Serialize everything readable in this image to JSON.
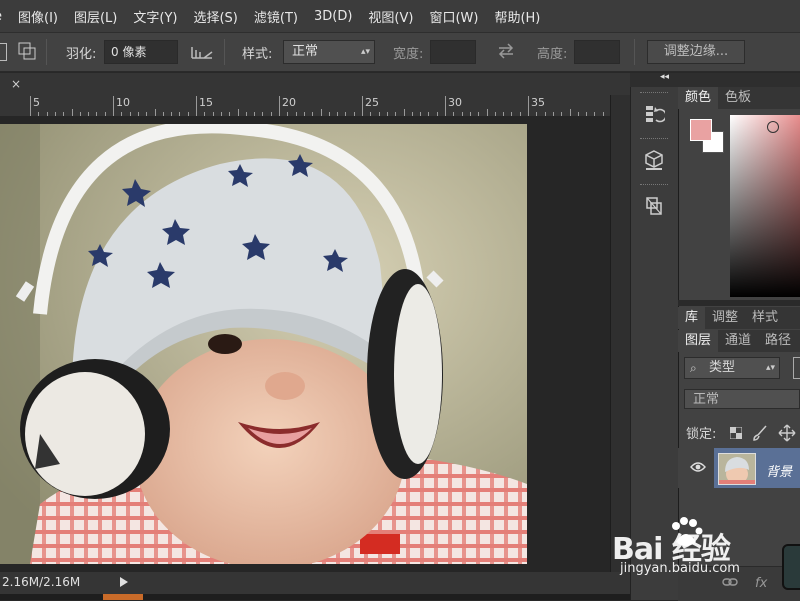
{
  "menu": [
    "e",
    "图像(I)",
    "图层(L)",
    "文字(Y)",
    "选择(S)",
    "滤镜(T)",
    "3D(D)",
    "视图(V)",
    "窗口(W)",
    "帮助(H)"
  ],
  "options": {
    "feather_label": "羽化:",
    "feather_value": "0 像素",
    "style_label": "样式:",
    "style_value": "正常",
    "width_label": "宽度:",
    "height_label": "高度:",
    "refine_edge_label": "调整边缘..."
  },
  "doc_tab": {
    "close_glyph": "×"
  },
  "ruler": {
    "labels": [
      "5",
      "10",
      "15",
      "20",
      "25",
      "30",
      "35"
    ]
  },
  "status": {
    "doc_size": "2.16M/2.16M"
  },
  "dock": {
    "collapse_glyph": "◂◂"
  },
  "panels": {
    "color_tabs": [
      "颜色",
      "色板"
    ],
    "lib_tabs": [
      "库",
      "调整",
      "样式"
    ],
    "layer_tabs": [
      "图层",
      "通道",
      "路径"
    ],
    "kind_filter": "类型",
    "blend_mode": "正常",
    "lock_label": "锁定:",
    "layer_name": "背景",
    "fx": "fx"
  },
  "colors": {
    "foreground": "#e9a2a2",
    "background": "#ffffff",
    "selected_layer": "#5a7096"
  },
  "watermark": {
    "logo": "Bai  经验",
    "url": "jingyan.baidu.com"
  }
}
